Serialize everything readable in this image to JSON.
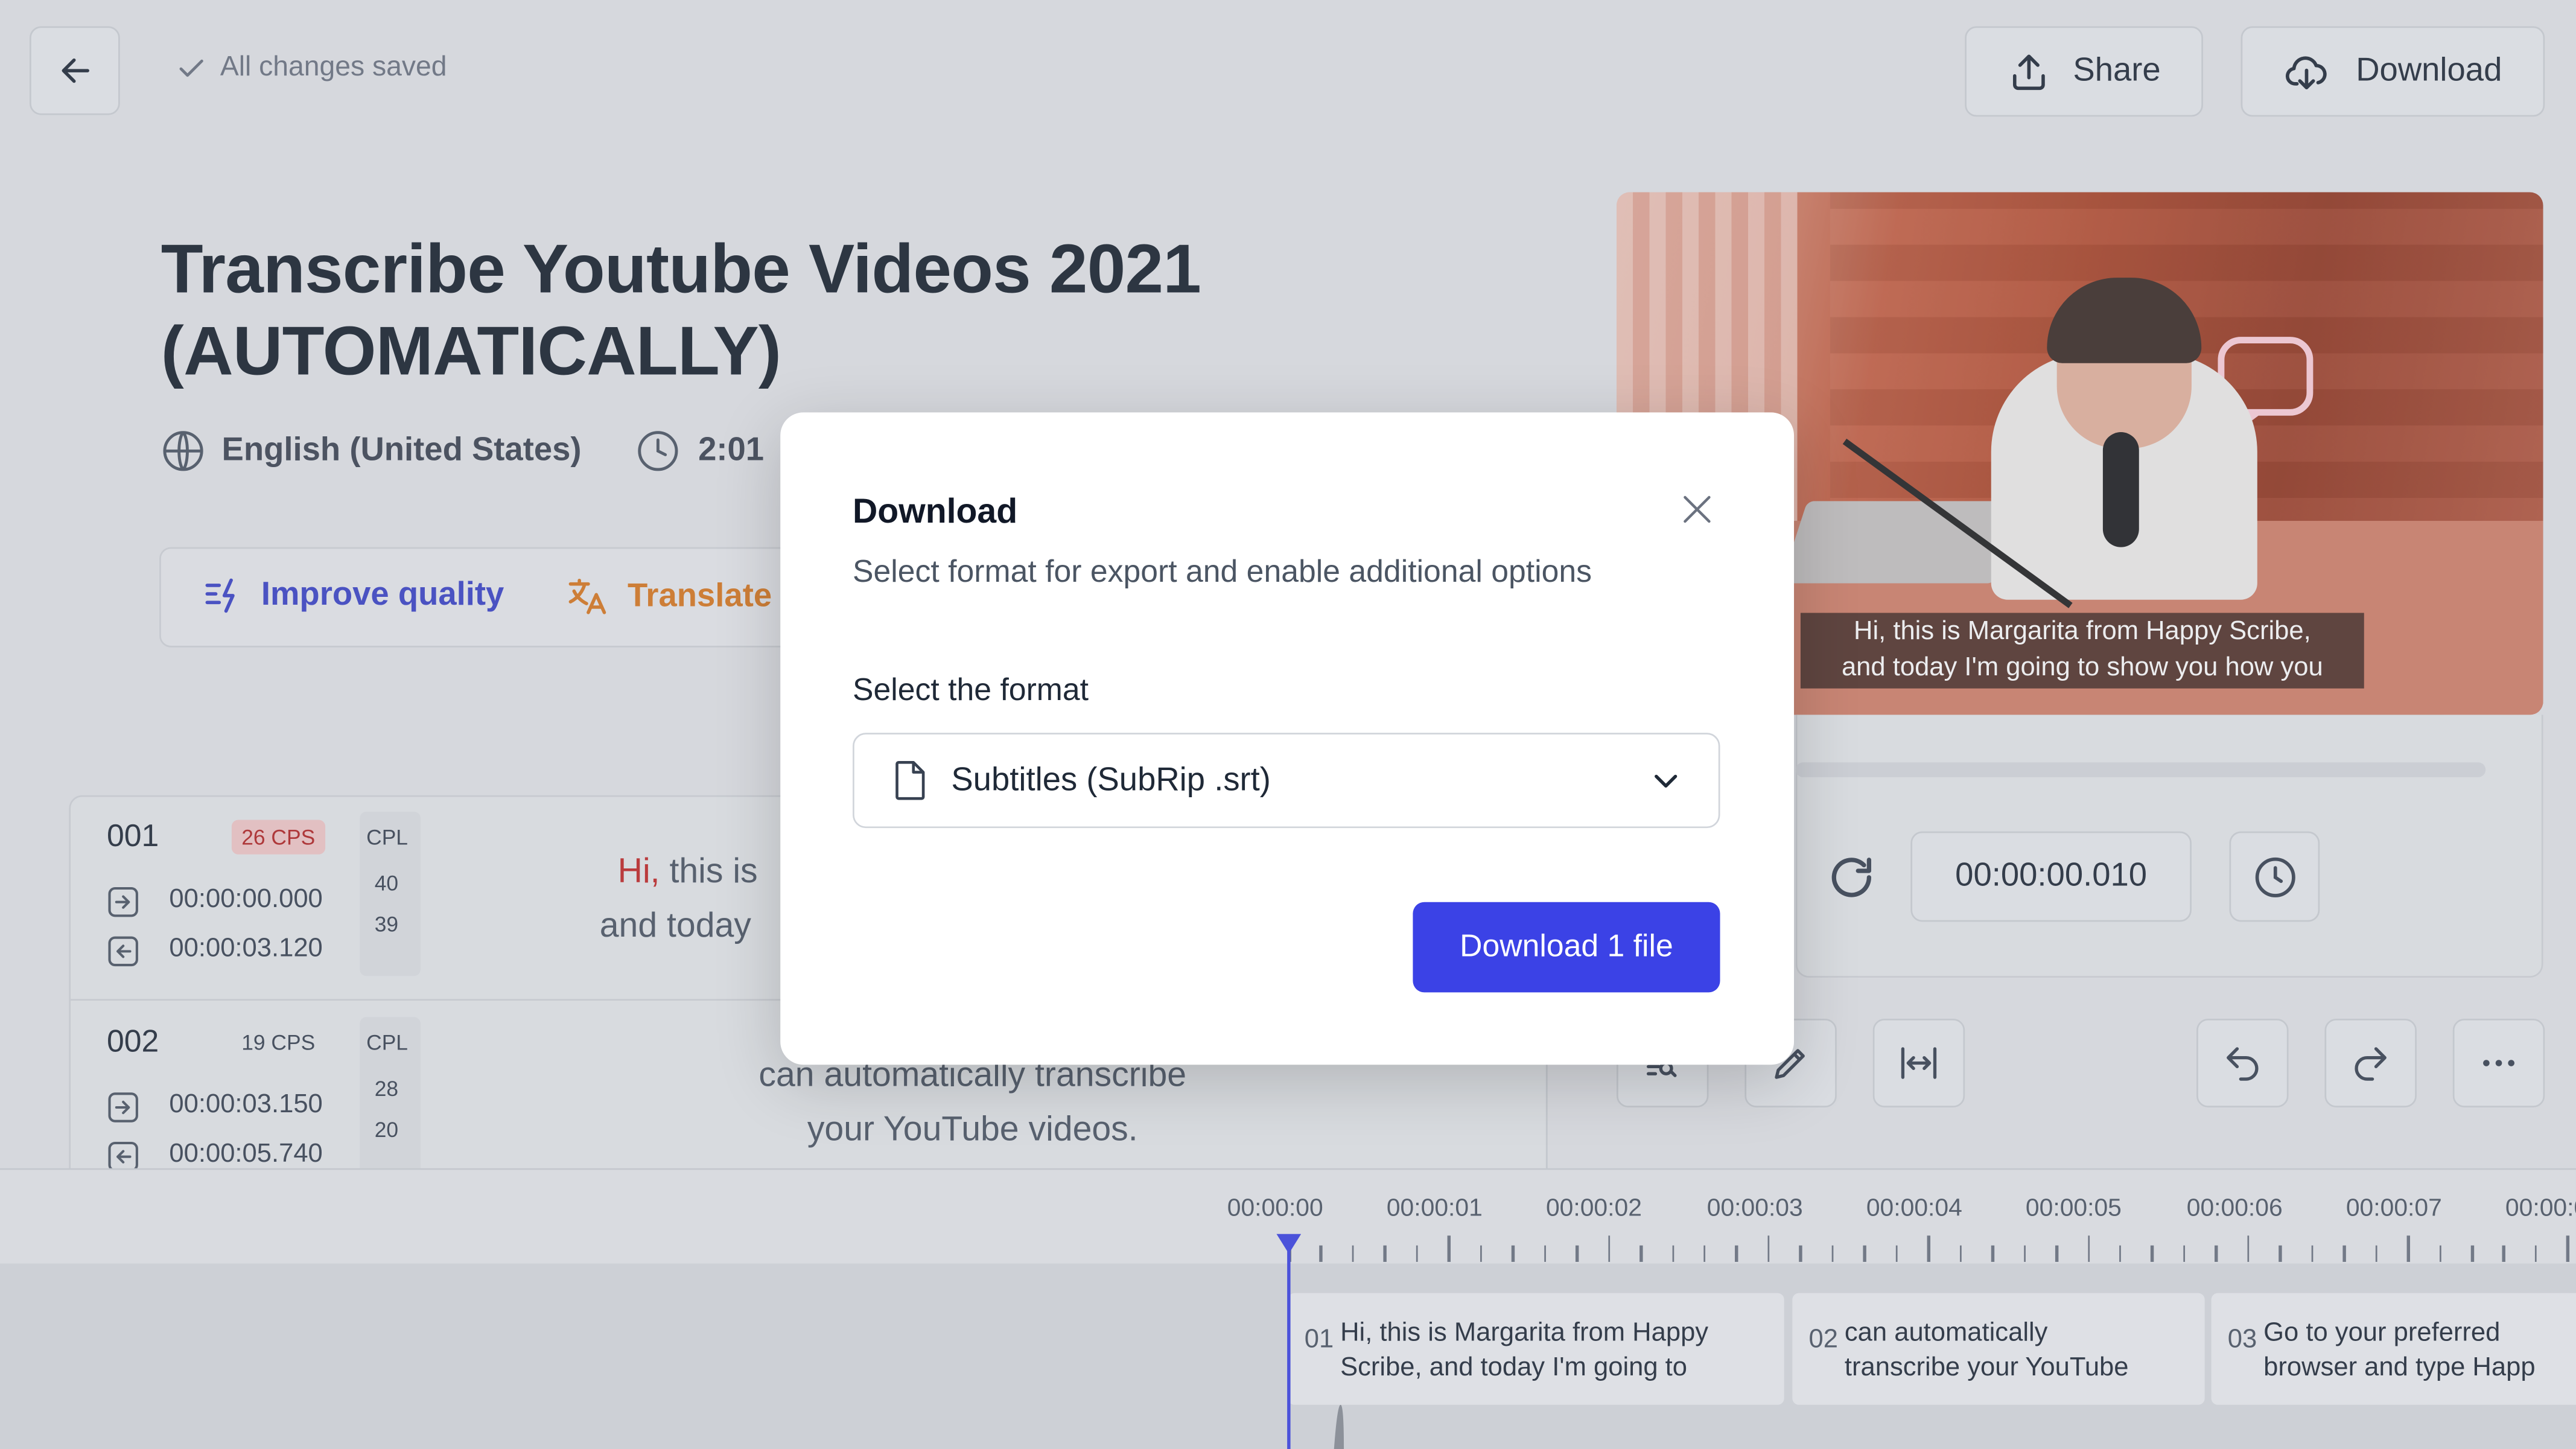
{
  "header": {
    "save_status": "All changes saved",
    "share_label": "Share",
    "download_label": "Download"
  },
  "project": {
    "title_line1": "Transcribe Youtube Videos 2021",
    "title_line2": "(AUTOMATICALLY)",
    "language": "English (United States)",
    "duration": "2:01"
  },
  "actions": {
    "improve_label": "Improve quality",
    "translate_label": "Translate"
  },
  "segments": [
    {
      "num": "001",
      "cps": "26 CPS",
      "cpl_label": "CPL",
      "start": "00:00:00.000",
      "end": "00:00:03.120",
      "cpl1": "40",
      "cpl2": "39",
      "text_highlight": "Hi,",
      "text_line1_rest": " this is",
      "text_line2": "and today"
    },
    {
      "num": "002",
      "cps": "19 CPS",
      "cpl_label": "CPL",
      "start": "00:00:03.150",
      "end": "00:00:05.740",
      "cpl1": "28",
      "cpl2": "20",
      "text_line1": "can automatically transcribe",
      "text_line2": "your YouTube videos."
    }
  ],
  "video": {
    "caption_line1": "Hi, this is Margarita from Happy Scribe,",
    "caption_line2": "and today I'm going to show you how you"
  },
  "player": {
    "timecode": "00:00:00.010"
  },
  "timeline": {
    "ticks": [
      "00:00:00",
      "00:00:01",
      "00:00:02",
      "00:00:03",
      "00:00:04",
      "00:00:05",
      "00:00:06",
      "00:00:07",
      "00:00:0"
    ],
    "clips": [
      {
        "n": "01",
        "line1": "Hi, this is Margarita from Happy",
        "line2": "Scribe, and today I'm going to"
      },
      {
        "n": "02",
        "line1": "can automatically",
        "line2": "transcribe your YouTube"
      },
      {
        "n": "03",
        "line1": "Go to your preferred",
        "line2": "browser and type Happ"
      }
    ]
  },
  "modal": {
    "title": "Download",
    "subtitle": "Select format for export and enable additional options",
    "format_label": "Select the format",
    "format_value": "Subtitles (SubRip .srt)",
    "submit_label": "Download 1 file"
  },
  "colors": {
    "accent": "#3b42e6",
    "improve": "#3a43c9",
    "translate": "#d9781f",
    "cps_warn_bg": "#f3c9c9",
    "cps_warn_text": "#b42323",
    "highlight_word": "#c22727",
    "playhead": "#3b42e6"
  }
}
